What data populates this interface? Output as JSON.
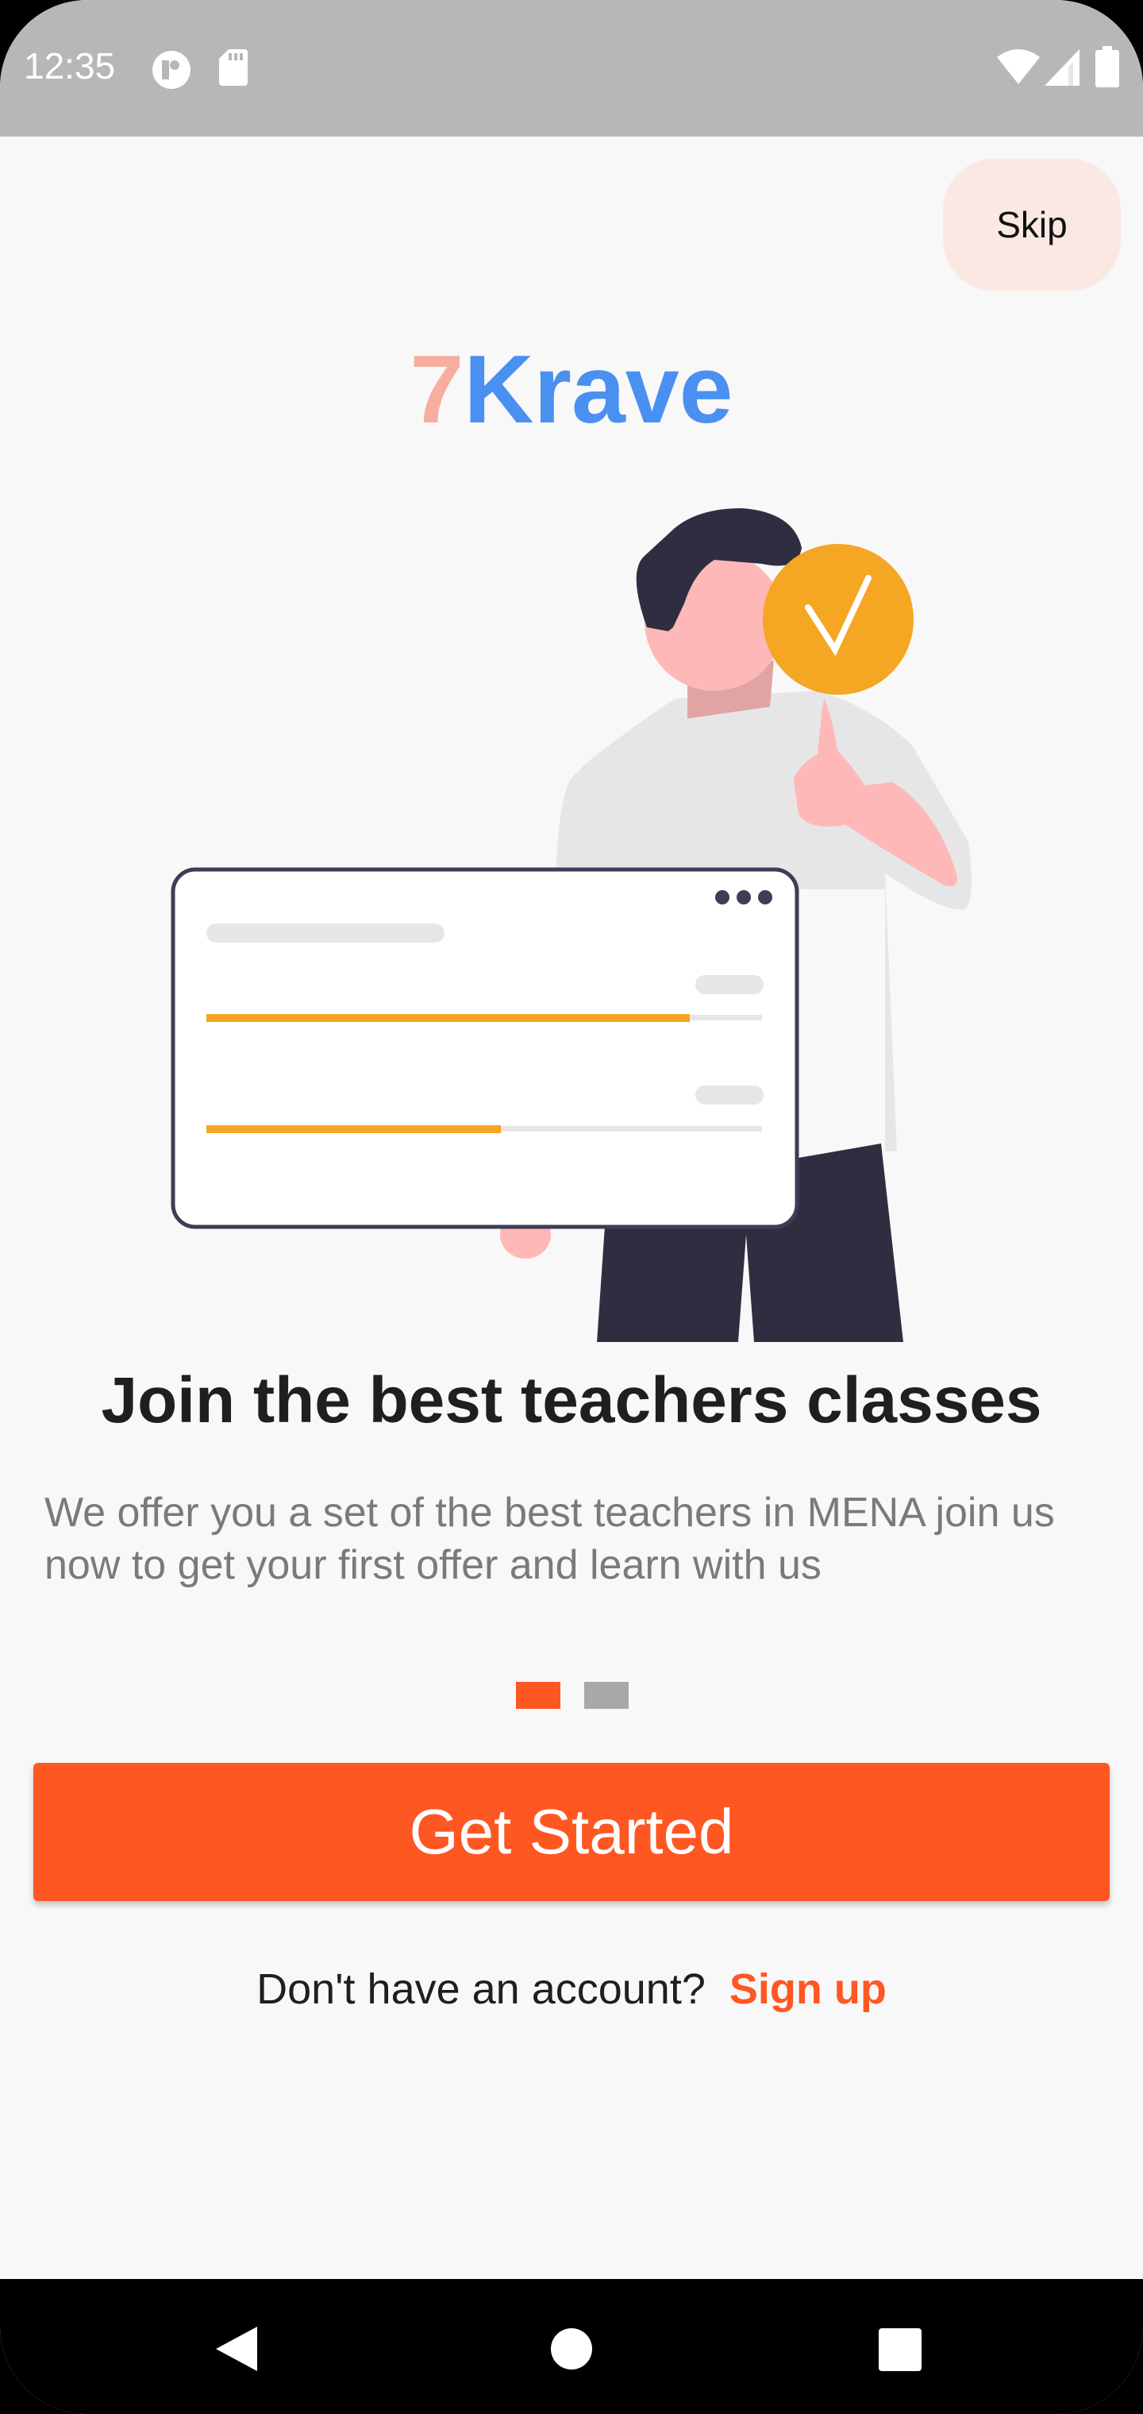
{
  "status_bar": {
    "time": "12:35",
    "icons": [
      "data-saver-icon",
      "sd-card-icon",
      "wifi-icon",
      "cellular-signal-icon",
      "battery-icon"
    ]
  },
  "header": {
    "skip_label": "Skip"
  },
  "logo": {
    "number": "7",
    "word": "Krave",
    "number_color": "#f7ae9f",
    "word_color": "#4a90f0"
  },
  "illustration": {
    "icon": "teacher-checkmark-illustration",
    "progress_bars": [
      0.87,
      0.53
    ],
    "accent_color": "#f5a623"
  },
  "onboarding": {
    "title": "Join the best teachers classes",
    "description": "We offer you a set of the best teachers in MENA join us now to get your first offer and learn with us",
    "page_count": 2,
    "current_page": 1
  },
  "actions": {
    "get_started_label": "Get Started",
    "signup_prompt": "Don't have an account?",
    "signup_link": "Sign up",
    "accent_color": "#ff5722"
  },
  "nav_bar": {
    "icons": [
      "back-icon",
      "home-icon",
      "recents-icon"
    ]
  }
}
